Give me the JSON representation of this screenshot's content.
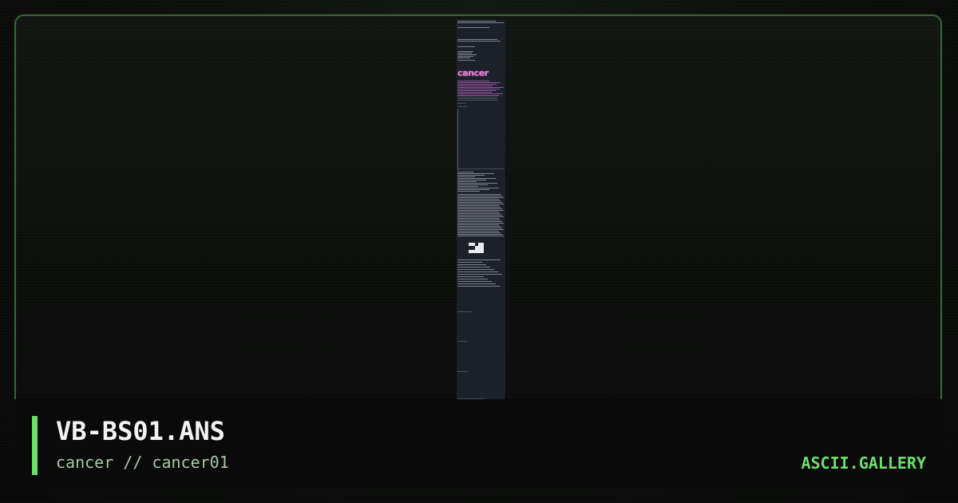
{
  "card": {
    "title": "VB-BS01.ANS",
    "subtitle": "cancer // cancer01",
    "brand": "ASCII.GALLERY"
  },
  "preview": {
    "logo_text": "cancer"
  },
  "colors": {
    "accent": "#6cde6c",
    "frame_border": "#2f6b34",
    "background": "#0a0d0a",
    "title": "#f2f4f2",
    "subtitle": "#a8c8a8",
    "art_background": "#1b1f27",
    "art_logo": "#e07ad0"
  }
}
